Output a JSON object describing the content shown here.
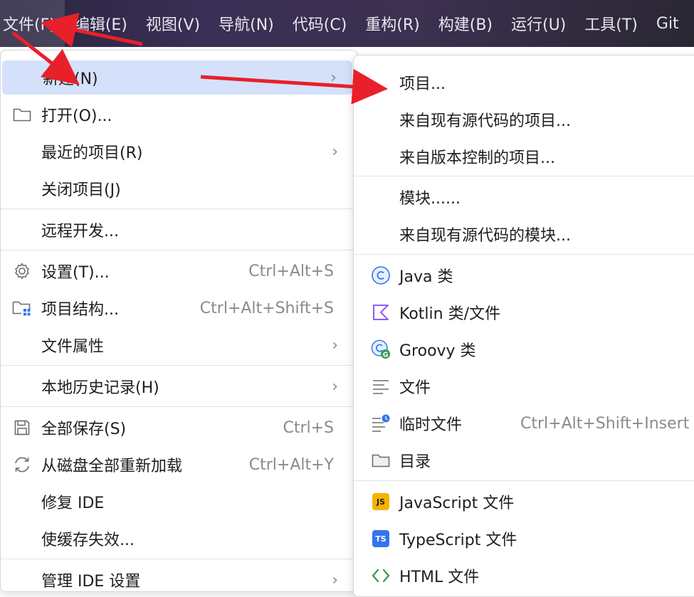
{
  "menubar": {
    "items": [
      {
        "label": "文件(F)"
      },
      {
        "label": "编辑(E)"
      },
      {
        "label": "视图(V)"
      },
      {
        "label": "导航(N)"
      },
      {
        "label": "代码(C)"
      },
      {
        "label": "重构(R)"
      },
      {
        "label": "构建(B)"
      },
      {
        "label": "运行(U)"
      },
      {
        "label": "工具(T)"
      },
      {
        "label": "Git"
      }
    ]
  },
  "file_menu": {
    "items": [
      {
        "label": "新建(N)"
      },
      {
        "label": "打开(O)..."
      },
      {
        "label": "最近的项目(R)"
      },
      {
        "label": "关闭项目(J)"
      },
      {
        "label": "远程开发..."
      },
      {
        "label": "设置(T)...",
        "shortcut": "Ctrl+Alt+S"
      },
      {
        "label": "项目结构...",
        "shortcut": "Ctrl+Alt+Shift+S"
      },
      {
        "label": "文件属性"
      },
      {
        "label": "本地历史记录(H)"
      },
      {
        "label": "全部保存(S)",
        "shortcut": "Ctrl+S"
      },
      {
        "label": "从磁盘全部重新加载",
        "shortcut": "Ctrl+Alt+Y"
      },
      {
        "label": "修复 IDE"
      },
      {
        "label": "使缓存失效..."
      },
      {
        "label": "管理 IDE 设置"
      }
    ]
  },
  "new_submenu": {
    "items": [
      {
        "label": "项目..."
      },
      {
        "label": "来自现有源代码的项目..."
      },
      {
        "label": "来自版本控制的项目..."
      },
      {
        "label": "模块......"
      },
      {
        "label": "来自现有源代码的模块..."
      },
      {
        "label": "Java 类"
      },
      {
        "label": "Kotlin 类/文件"
      },
      {
        "label": "Groovy 类"
      },
      {
        "label": "文件"
      },
      {
        "label": "临时文件",
        "shortcut": "Ctrl+Alt+Shift+Insert"
      },
      {
        "label": "目录"
      },
      {
        "label": "JavaScript 文件",
        "badge": "JS"
      },
      {
        "label": "TypeScript 文件",
        "badge": "TS"
      },
      {
        "label": "HTML 文件"
      }
    ]
  },
  "colors": {
    "selection": "#d5e1fa",
    "arrow": "#e8202a",
    "java": "#3574f0",
    "kotlin": "#8c5cf0",
    "groovy_badge": "#2e9e4f",
    "js_badge": "#f4b400",
    "ts_badge": "#3574f0",
    "html": "#2e9e4f"
  }
}
